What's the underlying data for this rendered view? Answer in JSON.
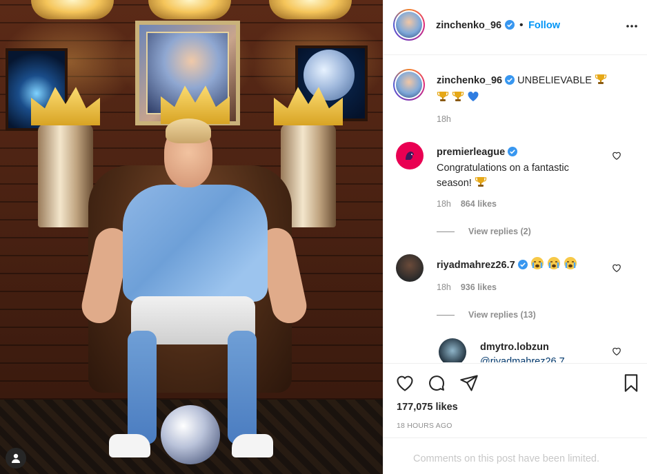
{
  "post": {
    "author": "zinchenko_96",
    "follow_label": "Follow",
    "separator": "•",
    "caption_text": "UNBELIEVABLE",
    "caption_time": "18h",
    "likes": "177,075 likes",
    "time_ago": "18 HOURS AGO",
    "comments_limited": "Comments on this post have been limited."
  },
  "comments": [
    {
      "username": "premierleague",
      "text": "Congratulations on a fantastic season!",
      "time": "18h",
      "likes": "864 likes",
      "view_replies": "View replies (2)"
    },
    {
      "username": "riyadmahrez26.7",
      "text": "",
      "time": "18h",
      "likes": "936 likes",
      "view_replies": "View replies (13)"
    },
    {
      "username": "dmytro.lobzun",
      "text": "@riyadmahrez26.7"
    }
  ],
  "colors": {
    "accent": "#0095f6",
    "verified": "#3897f0",
    "muted": "#8e8e8e",
    "premierleague_brand": "#e90052"
  },
  "icons": {
    "more": "more-options-icon",
    "like": "heart-icon",
    "comment": "comment-icon",
    "share": "paper-plane-icon",
    "save": "bookmark-icon",
    "user": "user-tag-icon"
  }
}
